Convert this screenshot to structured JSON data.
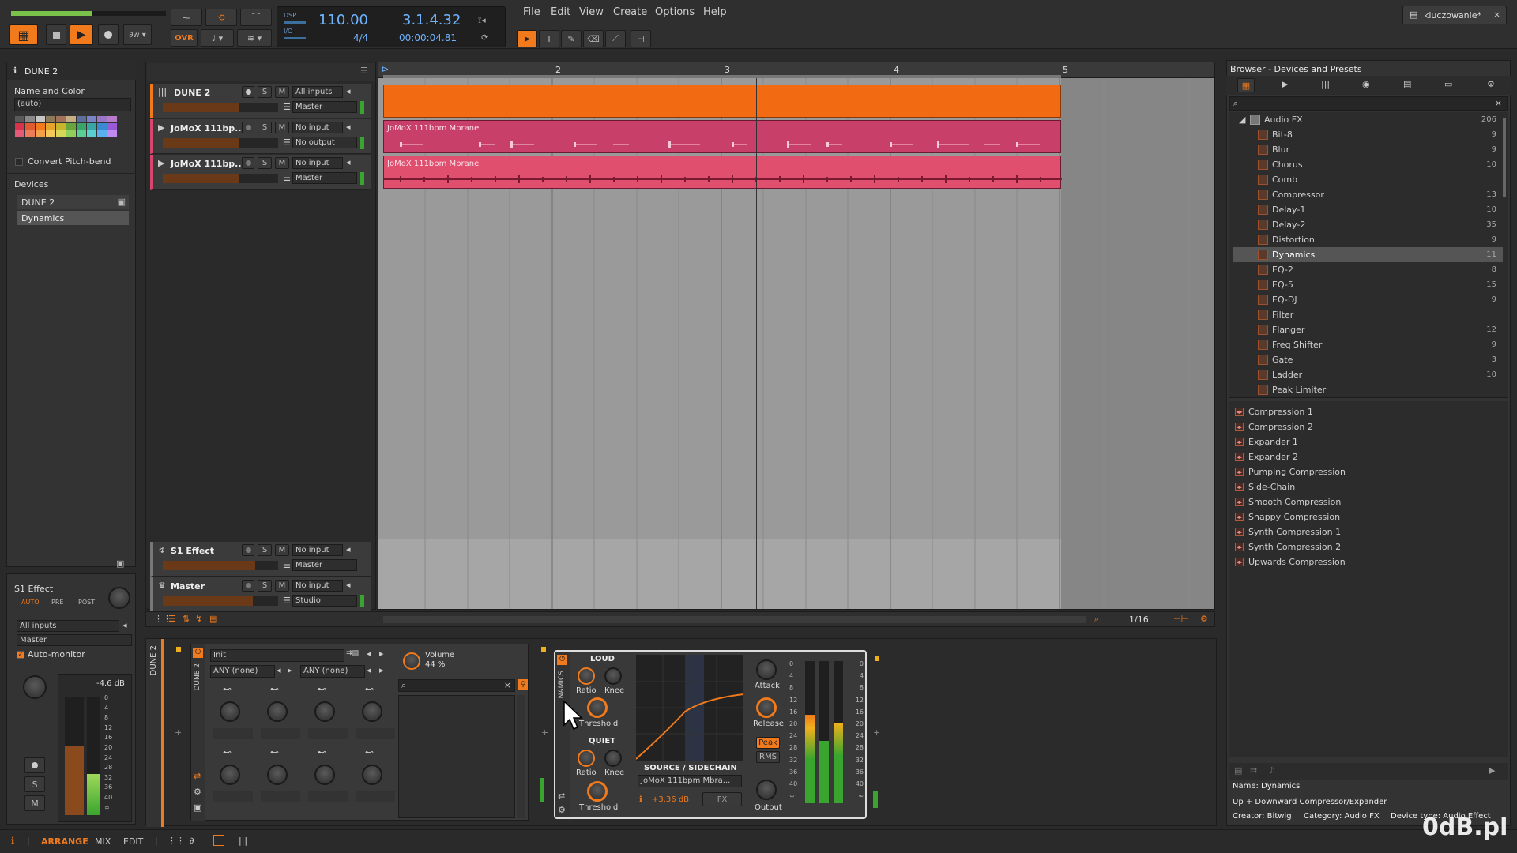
{
  "transport": {
    "tempo": "110.00",
    "position": "3.1.4.32",
    "signature": "4/4",
    "time": "00:00:04.81",
    "ovr_label": "OVR",
    "dsp_label": "DSP",
    "io_label": "I/O"
  },
  "menu": [
    "File",
    "Edit",
    "View",
    "Create",
    "Options",
    "Help"
  ],
  "project_tab": "kluczowanie*",
  "inspector": {
    "track_title": "DUNE 2",
    "name_color_label": "Name and Color",
    "name_value": "(auto)",
    "convert_pitchbend": "Convert Pitch-bend",
    "devices_label": "Devices",
    "devices": [
      "DUNE 2",
      "Dynamics"
    ],
    "send_title": "S1 Effect",
    "send_modes": [
      "AUTO",
      "PRE",
      "POST"
    ],
    "input": "All inputs",
    "output": "Master",
    "auto_monitor": "Auto-monitor",
    "db_value": "-4.6 dB",
    "meter_scale": [
      "0",
      "4",
      "8",
      "12",
      "16",
      "20",
      "24",
      "28",
      "32",
      "36",
      "40",
      "∞"
    ],
    "solo": "S",
    "mute": "M"
  },
  "tracks": [
    {
      "name": "DUNE 2",
      "input": "All inputs",
      "output": "Master",
      "solo": "S",
      "mute": "M"
    },
    {
      "name": "JoMoX 111bp...",
      "input": "No input",
      "output": "No output",
      "solo": "S",
      "mute": "M"
    },
    {
      "name": "JoMoX 111bp...",
      "input": "No input",
      "output": "Master",
      "solo": "S",
      "mute": "M"
    },
    {
      "name": "S1 Effect",
      "input": "No input",
      "output": "Master",
      "solo": "S",
      "mute": "M"
    },
    {
      "name": "Master",
      "input": "No input",
      "output": "Studio",
      "solo": "S",
      "mute": "M"
    }
  ],
  "ruler": [
    "2",
    "3",
    "4",
    "5"
  ],
  "clips": [
    "JoMoX 111bpm Mbrane",
    "JoMoX 111bpm Mbrane"
  ],
  "arranger_footer": {
    "grid": "1/16"
  },
  "device_panel": {
    "track_label": "DUNE 2",
    "preset": "Init",
    "mod_a": "ANY (none)",
    "mod_b": "ANY (none)",
    "volume_label": "Volume",
    "volume_value": "44 %",
    "dune_label": "DUNE 2"
  },
  "dynamics": {
    "title": "NAMICS",
    "loud": "LOUD",
    "quiet": "QUIET",
    "ratio": "Ratio",
    "knee": "Knee",
    "threshold": "Threshold",
    "attack": "Attack",
    "release": "Release",
    "peak": "Peak",
    "rms": "RMS",
    "output": "Output",
    "sidechain_label": "SOURCE / SIDECHAIN",
    "sidechain_source": "JoMoX 111bpm Mbra...",
    "gain": "+3.36 dB",
    "fx": "FX",
    "meter_scale": [
      "0",
      "4",
      "8",
      "12",
      "16",
      "20",
      "24",
      "28",
      "32",
      "36",
      "40",
      "∞"
    ]
  },
  "browser": {
    "title": "Browser - Devices and Presets",
    "category": "Audio FX",
    "category_count": "206",
    "items": [
      {
        "name": "Bit-8",
        "count": "9"
      },
      {
        "name": "Blur",
        "count": "9"
      },
      {
        "name": "Chorus",
        "count": "10"
      },
      {
        "name": "Comb",
        "count": ""
      },
      {
        "name": "Compressor",
        "count": "13"
      },
      {
        "name": "Delay-1",
        "count": "10"
      },
      {
        "name": "Delay-2",
        "count": "35"
      },
      {
        "name": "Distortion",
        "count": "9"
      },
      {
        "name": "Dynamics",
        "count": "11"
      },
      {
        "name": "EQ-2",
        "count": "8"
      },
      {
        "name": "EQ-5",
        "count": "15"
      },
      {
        "name": "EQ-DJ",
        "count": "9"
      },
      {
        "name": "Filter",
        "count": ""
      },
      {
        "name": "Flanger",
        "count": "12"
      },
      {
        "name": "Freq Shifter",
        "count": "9"
      },
      {
        "name": "Gate",
        "count": "3"
      },
      {
        "name": "Ladder",
        "count": "10"
      },
      {
        "name": "Peak Limiter",
        "count": ""
      }
    ],
    "presets": [
      "Compression 1",
      "Compression 2",
      "Expander 1",
      "Expander 2",
      "Pumping Compression",
      "Side-Chain",
      "Smooth Compression",
      "Snappy Compression",
      "Synth Compression 1",
      "Synth Compression 2",
      "Upwards Compression"
    ],
    "info_name": "Name: Dynamics",
    "info_desc": "Up + Downward Compressor/Expander",
    "info_creator": "Creator: Bitwig",
    "info_category": "Category: Audio FX",
    "info_type": "Device type: Audio Effect"
  },
  "footer": {
    "arrange": "ARRANGE",
    "mix": "MIX",
    "edit": "EDIT"
  },
  "watermark": "0dB.pl",
  "colors": {
    "accent": "#f07a1c",
    "clip_orange": "#f26a12",
    "clip_pink": "#d8466e"
  }
}
